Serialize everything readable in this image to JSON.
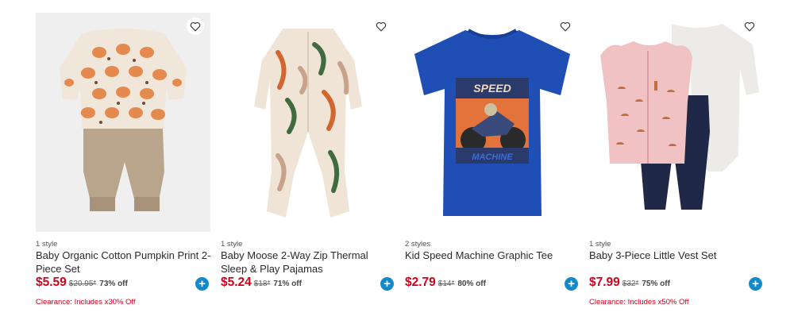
{
  "products": [
    {
      "styles": "1 style",
      "name": "Baby Organic Cotton Pumpkin Print 2-Piece Set",
      "price": "$5.59",
      "original_price": "$20.95*",
      "discount": "73% off",
      "promo": "Clearance: Includes x30% Off"
    },
    {
      "styles": "1 style",
      "name": "Baby Moose 2-Way Zip Thermal Sleep & Play Pajamas",
      "price": "$5.24",
      "original_price": "$18*",
      "discount": "71% off",
      "promo": ""
    },
    {
      "styles": "2 styles",
      "name": "Kid Speed Machine Graphic Tee",
      "price": "$2.79",
      "original_price": "$14*",
      "discount": "80% off",
      "promo": ""
    },
    {
      "styles": "1 style",
      "name": "Baby 3-Piece Little Vest Set",
      "price": "$7.99",
      "original_price": "$32*",
      "discount": "75% off",
      "promo": "Clearance: Includes x50% Off"
    }
  ],
  "tee_graphic": {
    "top_text": "SPEED",
    "bottom_text": "MACHINE"
  },
  "icons": {
    "favorite": "heart-outline-icon",
    "add": "plus-icon"
  },
  "colors": {
    "price": "#d0021b",
    "add_button": "#1389c9",
    "promo": "#d0021b"
  }
}
